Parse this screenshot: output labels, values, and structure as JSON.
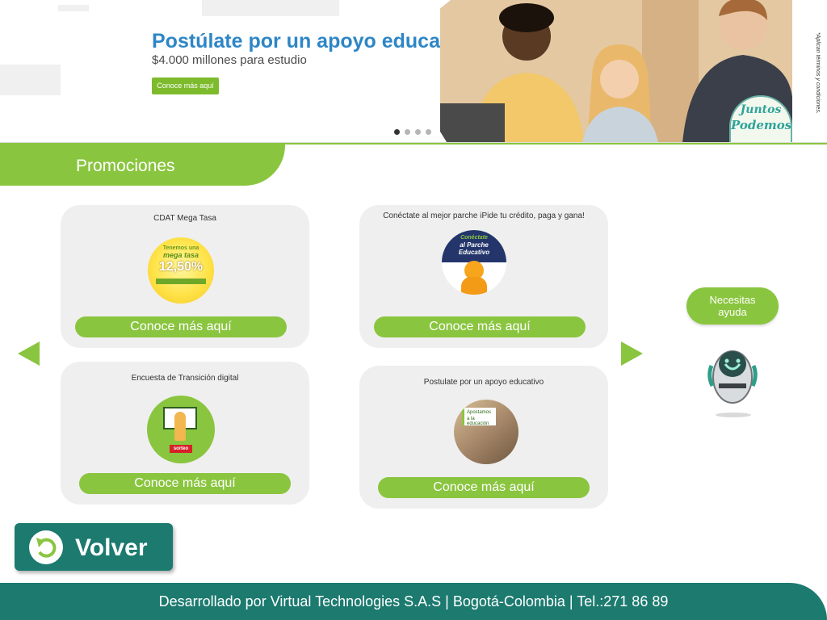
{
  "banner": {
    "title": "Postúlate por un apoyo educativo",
    "subtitle": "$4.000 millones para estudio",
    "cta_label": "Conoce más aquí",
    "side_note": "*Aplican términos y condiciones.",
    "logo_line1": "Juntos",
    "logo_line2": "Podemos",
    "slide_count": 4,
    "active_slide": 1
  },
  "section": {
    "title": "Promociones"
  },
  "promos": [
    {
      "title": "CDAT Mega Tasa",
      "button": "Conoce más aquí",
      "image_text": {
        "line1": "Tenemos una",
        "line2": "mega tasa",
        "rate": "12,50%"
      }
    },
    {
      "title": "Conéctate al mejor parche iPide tu crédito, paga y gana!",
      "button": "Conoce más aquí",
      "image_text": {
        "line1": "Conéctate",
        "line2": "al Parche",
        "line3": "Educativo"
      }
    },
    {
      "title": "Encuesta de Transición digital",
      "button": "Conoce más aquí",
      "image_text": {
        "badge": "sorteo"
      }
    },
    {
      "title": "Postulate por un apoyo educativo",
      "button": "Conoce más aquí",
      "image_text": {
        "line1": "Apostamos",
        "line2": "a la educación"
      }
    }
  ],
  "help": {
    "label_line1": "Necesitas",
    "label_line2": "ayuda"
  },
  "back_button": {
    "label": "Volver"
  },
  "footer": {
    "text": "Desarrollado por Virtual Technologies S.A.S  |  Bogotá-Colombia  |  Tel.:271 86 89"
  },
  "colors": {
    "brand_green": "#8ac53f",
    "brand_teal": "#1c7a6f",
    "title_blue": "#2e86c6",
    "card_bg": "#efefef"
  }
}
